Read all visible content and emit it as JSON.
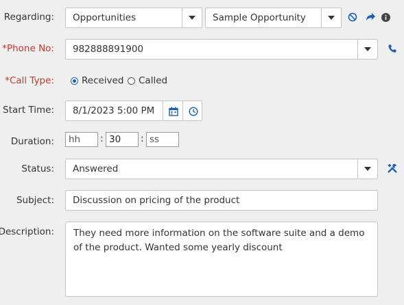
{
  "form": {
    "regarding": {
      "label": "Regarding:",
      "entity_type": "Opportunities",
      "entity_name": "Sample Opportunity",
      "icons": [
        "block-icon",
        "share-arrow-icon",
        "info-icon"
      ]
    },
    "phone": {
      "label": "*Phone No:",
      "value": "982888891900",
      "icon": "phone-icon"
    },
    "call_type": {
      "label": "*Call Type:",
      "options": [
        "Received",
        "Called"
      ],
      "selected": "Received"
    },
    "start_time": {
      "label": "Start Time:",
      "value": "8/1/2023 5:00 PM",
      "icons": [
        "calendar-icon",
        "clock-icon"
      ]
    },
    "duration": {
      "label": "Duration:",
      "hours_placeholder": "hh",
      "minutes_value": "30",
      "seconds_placeholder": "ss",
      "separator": ":"
    },
    "status": {
      "label": "Status:",
      "value": "Answered",
      "icon": "tools-icon"
    },
    "subject": {
      "label": "Subject:",
      "value": "Discussion on pricing of the product"
    },
    "description": {
      "label": "Description:",
      "value": "They need more information on the software suite and a demo of the product. Wanted some yearly discount"
    }
  },
  "colors": {
    "background": "#efefef",
    "required_label": "#c0392b",
    "accent_blue": "#1a5fb4",
    "border": "#c3c3c3"
  }
}
